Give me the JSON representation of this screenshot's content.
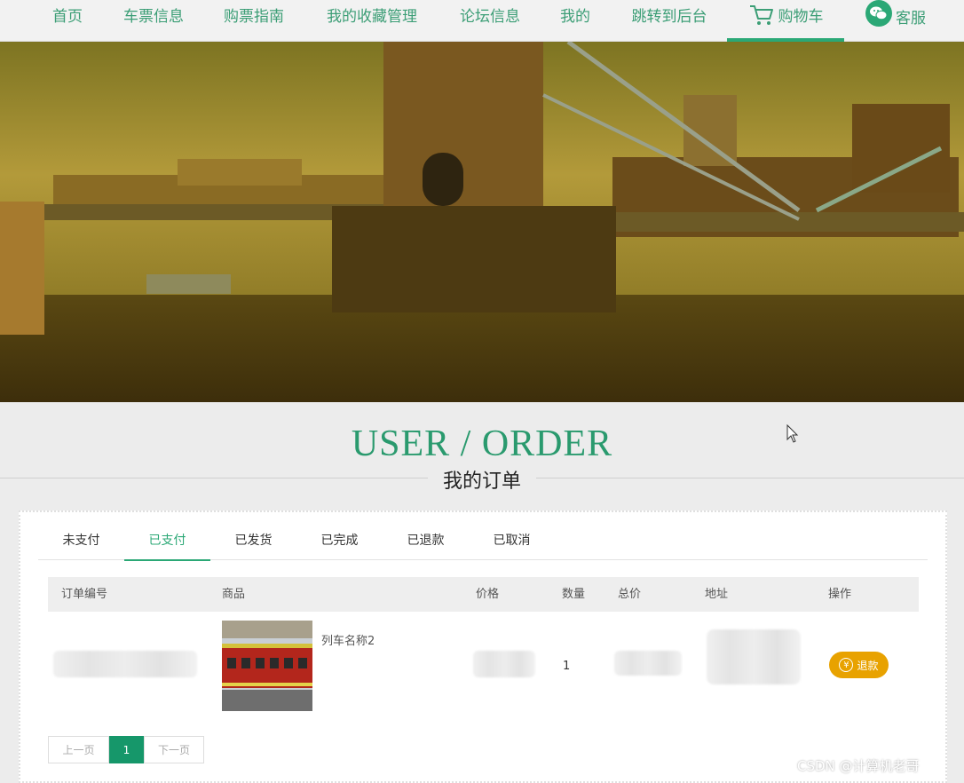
{
  "nav": {
    "items": [
      {
        "label": "首页"
      },
      {
        "label": "车票信息"
      },
      {
        "label": "购票指南"
      },
      {
        "label": "我的收藏管理"
      },
      {
        "label": "论坛信息"
      },
      {
        "label": "我的"
      },
      {
        "label": "跳转到后台"
      },
      {
        "label": "购物车",
        "icon": "cart-icon"
      },
      {
        "label": "客服",
        "icon": "wechat-icon"
      }
    ],
    "active": "购物车",
    "accent_color": "#2ba876"
  },
  "page": {
    "title": "USER / ORDER",
    "subtitle": "我的订单"
  },
  "tabs": [
    {
      "label": "未支付"
    },
    {
      "label": "已支付"
    },
    {
      "label": "已发货"
    },
    {
      "label": "已完成"
    },
    {
      "label": "已退款"
    },
    {
      "label": "已取消"
    }
  ],
  "active_tab": "已支付",
  "table": {
    "headers": [
      "订单编号",
      "商品",
      "价格",
      "数量",
      "总价",
      "地址",
      "操作"
    ],
    "rows": [
      {
        "product_name": "列车名称2",
        "quantity": "1",
        "action_label": "退款",
        "action_icon": "yen-icon"
      }
    ]
  },
  "pagination": {
    "prev": "上一页",
    "current": "1",
    "next": "下一页"
  },
  "watermark": "CSDN @计算机老哥"
}
